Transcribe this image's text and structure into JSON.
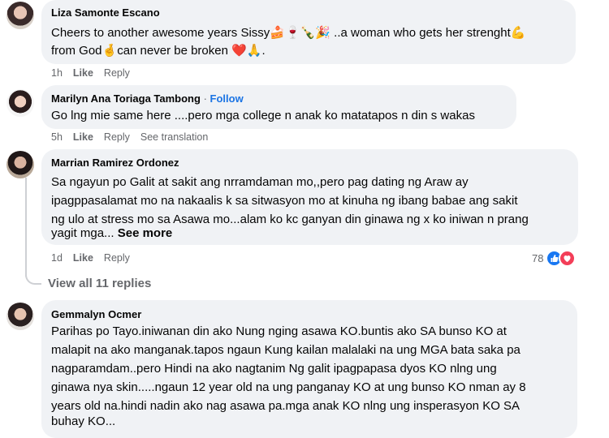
{
  "comments": [
    {
      "author": "Liza Samonte Escano",
      "lines": [
        "Cheers to another awesome years Sissy🍰🍷🍾🎉 ..a woman who gets her strenght💪",
        "from God🤞can never be broken ❤️🙏."
      ],
      "time": "1h",
      "like": "Like",
      "reply": "Reply"
    },
    {
      "author": "Marilyn Ana Toriaga Tambong",
      "separator": "·",
      "follow": "Follow",
      "lines": [
        "Go lng mie same here ....pero mga college n anak ko matatapos n din s wakas"
      ],
      "time": "5h",
      "like": "Like",
      "reply": "Reply",
      "translate": "See translation"
    },
    {
      "author": "Marrian Ramirez Ordonez",
      "lines": [
        "Sa ngayun po Galit at sakit ang nrramdaman mo,,pero pag dating ng Araw ay",
        "ipagppasalamat mo na nakaalis k sa sitwasyon mo at kinuha ng ibang babae ang sakit",
        "ng ulo at stress mo sa Asawa mo...alam ko kc ganyan din ginawa ng x ko iniwan n prang",
        "yagit mga..."
      ],
      "see_more": "See more",
      "time": "1d",
      "like": "Like",
      "reply": "Reply",
      "reaction_count": "78",
      "reactions": [
        "like-icon",
        "love-icon"
      ]
    },
    {
      "author": "Gemmalyn Ocmer",
      "lines": [
        "Parihas po Tayo.iniwanan din ako Nung nging asawa KO.buntis ako SA bunso KO at",
        "malapit na ako manganak.tapos ngaun Kung kailan malalaki na ung MGA bata saka pa",
        "nagparamdam..pero Hindi na ako nagtanim Ng galit ipagpapasa dyos KO nlng ung",
        "ginawa nya skin.....ngaun 12 year old na ung panganay KO at ung bunso KO nman ay 8",
        "years old na.hindi nadin ako nag asawa pa.mga anak KO nlng ung insperasyon KO SA",
        "buhay KO..."
      ]
    }
  ],
  "view_replies": "View all 11 replies",
  "colors": {
    "bubble": "#f0f2f5",
    "meta": "#65676b",
    "link": "#1b74e4",
    "like": "#1877f2",
    "love": "#f33e58"
  }
}
